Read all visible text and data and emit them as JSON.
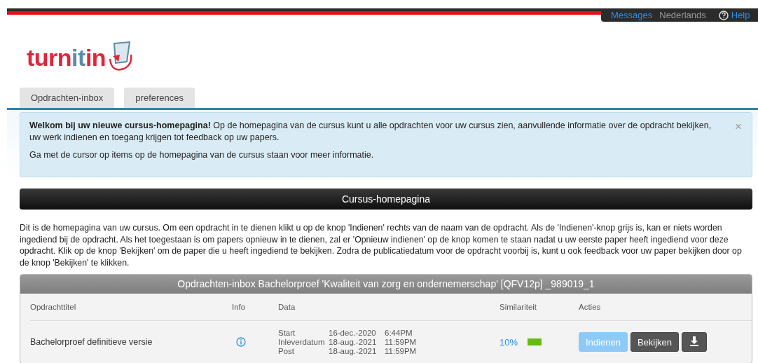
{
  "top_links": {
    "messages": "Messages",
    "language": "Nederlands",
    "help": "Help"
  },
  "logo": {
    "parts": [
      "turn",
      "it",
      "in"
    ]
  },
  "tabs": [
    {
      "label": "Opdrachten-inbox"
    },
    {
      "label": "preferences"
    }
  ],
  "alert": {
    "lines": [
      "**Welkom bij uw nieuwe cursus-homepagina!** Op de homepagina van de cursus kunt u alle opdrachten voor uw cursus zien, aanvullende informatie over de opdracht bekijken, uw werk indienen en toegang krijgen tot feedback op uw papers.",
      "Ga met de cursor op items op de homepagina van de cursus staan voor meer informatie."
    ],
    "close": "×"
  },
  "section_title": "Cursus-homepagina",
  "intro": "Dit is de homepagina van uw cursus. Om een opdracht in te dienen klikt u op de knop 'Indienen' rechts van de naam van de opdracht. Als de 'Indienen'-knop grijs is, kan er niets worden ingediend bij de opdracht. Als het toegestaan is om papers opnieuw in te dienen, zal er 'Opnieuw indienen' op de knop komen te staan nadat u uw eerste paper heeft ingediend voor deze opdracht. Klik op de knop 'Bekijken' om de paper die u heeft ingediend te bekijken. Zodra de publicatiedatum voor de opdracht voorbij is, kunt u ook feedback voor uw paper bekijken door op de knop 'Bekijken' te klikken.",
  "inbox": {
    "title": "Opdrachten-inbox Bachelorproef 'Kwaliteit van zorg en ondernemerschap' [QFV12p] _989019_1",
    "columns": [
      "Opdrachttitel",
      "Info",
      "Data",
      "Similariteit",
      "Acties"
    ],
    "rows": [
      {
        "title": "Bachelorproef definitieve versie",
        "dates": [
          {
            "label": "Start",
            "date": "16-dec.-2020",
            "time": "6:44PM"
          },
          {
            "label": "Inleverdatum",
            "date": "18-aug.-2021",
            "time": "11:59PM"
          },
          {
            "label": "Post",
            "date": "18-aug.-2021",
            "time": "11:59PM"
          }
        ],
        "similarity": "10%",
        "color": "#66bb11",
        "submit": {
          "label": "Indienen",
          "disabled": true
        },
        "view": {
          "label": "Bekijken"
        }
      }
    ]
  }
}
